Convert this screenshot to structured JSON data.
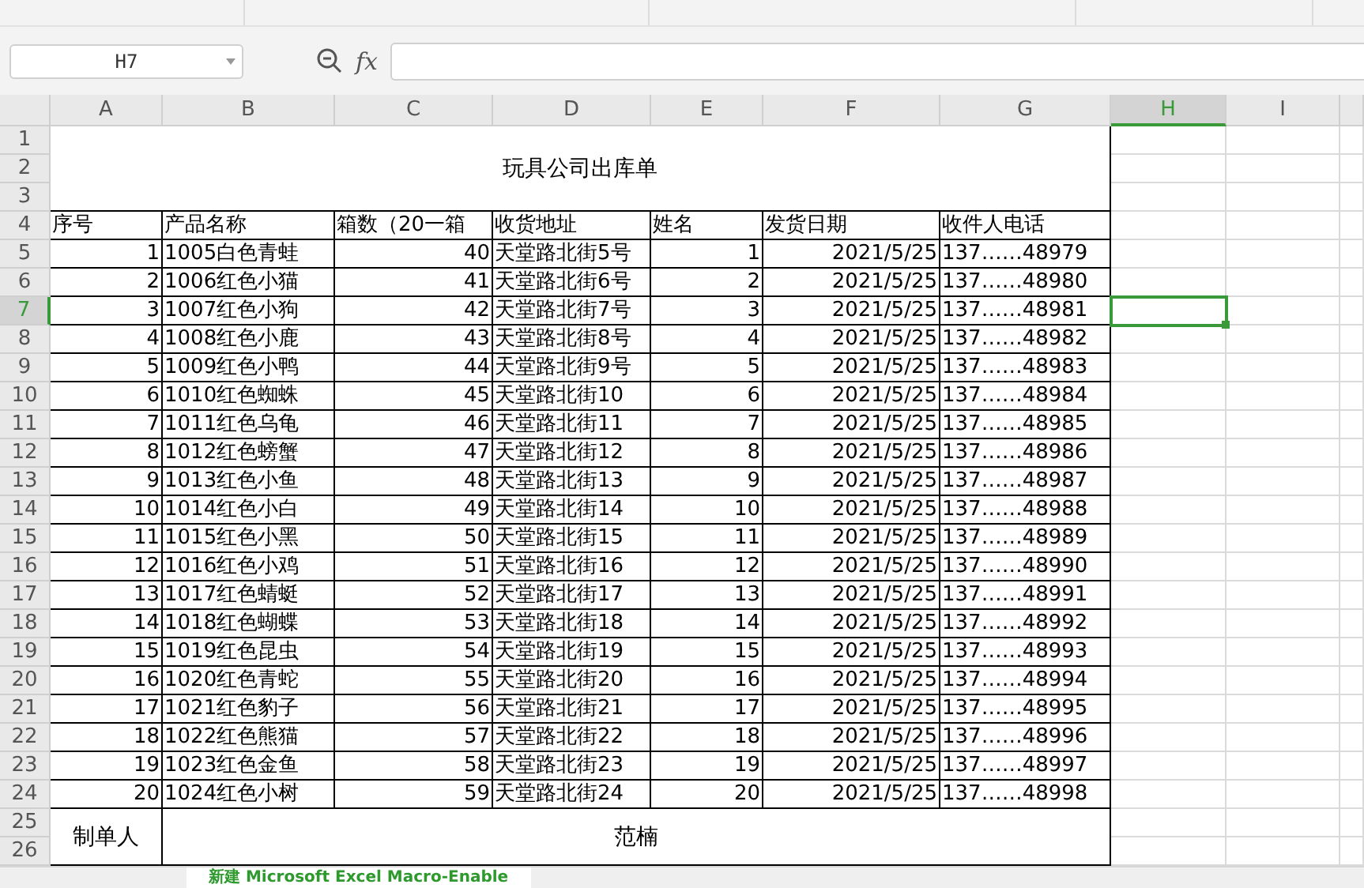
{
  "name_box": "H7",
  "fx_label": "fx",
  "columns": [
    {
      "label": "A",
      "selected": false
    },
    {
      "label": "B",
      "selected": false
    },
    {
      "label": "C",
      "selected": false
    },
    {
      "label": "D",
      "selected": false
    },
    {
      "label": "E",
      "selected": false
    },
    {
      "label": "F",
      "selected": false
    },
    {
      "label": "G",
      "selected": false
    },
    {
      "label": "H",
      "selected": true
    },
    {
      "label": "I",
      "selected": false
    }
  ],
  "row_numbers": [
    {
      "label": "1",
      "selected": false
    },
    {
      "label": "2",
      "selected": false
    },
    {
      "label": "3",
      "selected": false
    },
    {
      "label": "4",
      "selected": false
    },
    {
      "label": "5",
      "selected": false
    },
    {
      "label": "6",
      "selected": false
    },
    {
      "label": "7",
      "selected": true
    },
    {
      "label": "8",
      "selected": false
    },
    {
      "label": "9",
      "selected": false
    },
    {
      "label": "10",
      "selected": false
    },
    {
      "label": "11",
      "selected": false
    },
    {
      "label": "12",
      "selected": false
    },
    {
      "label": "13",
      "selected": false
    },
    {
      "label": "14",
      "selected": false
    },
    {
      "label": "15",
      "selected": false
    },
    {
      "label": "16",
      "selected": false
    },
    {
      "label": "17",
      "selected": false
    },
    {
      "label": "18",
      "selected": false
    },
    {
      "label": "19",
      "selected": false
    },
    {
      "label": "20",
      "selected": false
    },
    {
      "label": "21",
      "selected": false
    },
    {
      "label": "22",
      "selected": false
    },
    {
      "label": "23",
      "selected": false
    },
    {
      "label": "24",
      "selected": false
    },
    {
      "label": "25",
      "selected": false
    },
    {
      "label": "26",
      "selected": false
    }
  ],
  "title": "玩具公司出库单",
  "table": {
    "headers": [
      "序号",
      "产品名称",
      "箱数（20一箱",
      "收货地址",
      "姓名",
      "发货日期",
      "收件人电话"
    ],
    "rows": [
      [
        "1",
        "1005白色青蛙",
        "40",
        "天堂路北街5号",
        "1",
        "2021/5/25",
        "137……48979"
      ],
      [
        "2",
        "1006红色小猫",
        "41",
        "天堂路北街6号",
        "2",
        "2021/5/25",
        "137……48980"
      ],
      [
        "3",
        "1007红色小狗",
        "42",
        "天堂路北街7号",
        "3",
        "2021/5/25",
        "137……48981"
      ],
      [
        "4",
        "1008红色小鹿",
        "43",
        "天堂路北街8号",
        "4",
        "2021/5/25",
        "137……48982"
      ],
      [
        "5",
        "1009红色小鸭",
        "44",
        "天堂路北街9号",
        "5",
        "2021/5/25",
        "137……48983"
      ],
      [
        "6",
        "1010红色蜘蛛",
        "45",
        "天堂路北街10",
        "6",
        "2021/5/25",
        "137……48984"
      ],
      [
        "7",
        "1011红色乌龟",
        "46",
        "天堂路北街11",
        "7",
        "2021/5/25",
        "137……48985"
      ],
      [
        "8",
        "1012红色螃蟹",
        "47",
        "天堂路北街12",
        "8",
        "2021/5/25",
        "137……48986"
      ],
      [
        "9",
        "1013红色小鱼",
        "48",
        "天堂路北街13",
        "9",
        "2021/5/25",
        "137……48987"
      ],
      [
        "10",
        "1014红色小白",
        "49",
        "天堂路北街14",
        "10",
        "2021/5/25",
        "137……48988"
      ],
      [
        "11",
        "1015红色小黑",
        "50",
        "天堂路北街15",
        "11",
        "2021/5/25",
        "137……48989"
      ],
      [
        "12",
        "1016红色小鸡",
        "51",
        "天堂路北街16",
        "12",
        "2021/5/25",
        "137……48990"
      ],
      [
        "13",
        "1017红色蜻蜓",
        "52",
        "天堂路北街17",
        "13",
        "2021/5/25",
        "137……48991"
      ],
      [
        "14",
        "1018红色蝴蝶",
        "53",
        "天堂路北街18",
        "14",
        "2021/5/25",
        "137……48992"
      ],
      [
        "15",
        "1019红色昆虫",
        "54",
        "天堂路北街19",
        "15",
        "2021/5/25",
        "137……48993"
      ],
      [
        "16",
        "1020红色青蛇",
        "55",
        "天堂路北街20",
        "16",
        "2021/5/25",
        "137……48994"
      ],
      [
        "17",
        "1021红色豹子",
        "56",
        "天堂路北街21",
        "17",
        "2021/5/25",
        "137……48995"
      ],
      [
        "18",
        "1022红色熊猫",
        "57",
        "天堂路北街22",
        "18",
        "2021/5/25",
        "137……48996"
      ],
      [
        "19",
        "1023红色金鱼",
        "58",
        "天堂路北街23",
        "19",
        "2021/5/25",
        "137……48997"
      ],
      [
        "20",
        "1024红色小树",
        "59",
        "天堂路北街24",
        "20",
        "2021/5/25",
        "137……48998"
      ]
    ]
  },
  "footer": {
    "label": "制单人",
    "value": "范楠"
  },
  "sheet_tab": {
    "label": "新建 Microsoft Excel Macro-Enable",
    "selected": true
  }
}
